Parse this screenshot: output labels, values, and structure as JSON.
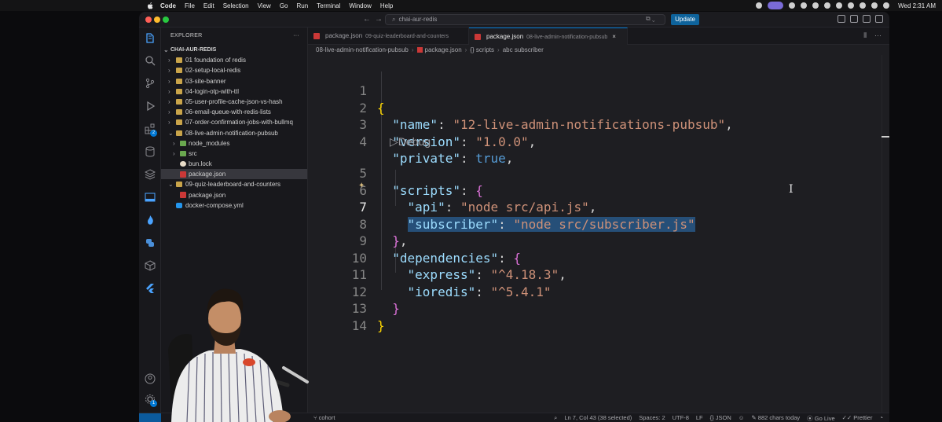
{
  "menubar": {
    "app_name": "Code",
    "items": [
      "File",
      "Edit",
      "Selection",
      "View",
      "Go",
      "Run",
      "Terminal",
      "Window",
      "Help"
    ],
    "clock": "Wed 2:31 AM"
  },
  "titlebar": {
    "search_text": "chai-aur-redis",
    "update_label": "Update"
  },
  "activity_badges": {
    "source_control": "2",
    "accounts": "1"
  },
  "explorer": {
    "title": "EXPLORER",
    "more": "···",
    "root": "CHAI-AUR-REDIS",
    "rows": [
      {
        "label": "01 foundation of redis"
      },
      {
        "label": "02-setup-local-redis"
      },
      {
        "label": "03-site-banner"
      },
      {
        "label": "04-login-otp-with-ttl"
      },
      {
        "label": "05-user-profile-cache-json-vs-hash"
      },
      {
        "label": "06-email-queue-with-redis-lists"
      },
      {
        "label": "07-order-confirmation-jobs-with-bullmq"
      },
      {
        "label": "08-live-admin-notification-pubsub"
      },
      {
        "label": "node_modules"
      },
      {
        "label": "src"
      },
      {
        "label": "bun.lock"
      },
      {
        "label": "package.json"
      },
      {
        "label": "09-quiz-leaderboard-and-counters"
      },
      {
        "label": "package.json"
      },
      {
        "label": "docker-compose.yml"
      }
    ]
  },
  "tabs": [
    {
      "label": "package.json",
      "sub": "09-quiz-leaderboard-and-counters"
    },
    {
      "label": "package.json",
      "sub": "08-live-admin-notification-pubsub",
      "close": "×"
    }
  ],
  "breadcrumb": {
    "folder": "08-live-admin-notification-pubsub",
    "file": "package.json",
    "section": "{} scripts",
    "symbol": "abc subscriber"
  },
  "editor": {
    "line_numbers": [
      "1",
      "2",
      "3",
      "4",
      "5",
      "6",
      "7",
      "8",
      "9",
      "10",
      "11",
      "12",
      "13",
      "14"
    ],
    "current_line": 7,
    "codelens": "Debug",
    "tokens": {
      "l1_open": "{",
      "name_key": "\"name\"",
      "name_val": "\"12-live-admin-notifications-pubsub\"",
      "version_key": "\"version\"",
      "version_val": "\"1.0.0\"",
      "private_key": "\"private\"",
      "private_val": "true",
      "scripts_key": "\"scripts\"",
      "api_key": "\"api\"",
      "api_val": "\"node src/api.js\"",
      "subscriber_key": "\"subscriber\"",
      "subscriber_val": "\"node src/subscriber.js\"",
      "deps_key": "\"dependencies\"",
      "express_key": "\"express\"",
      "express_val": "\"^4.18.3\"",
      "ioredis_key": "\"ioredis\"",
      "ioredis_val": "\"^5.4.1\""
    }
  },
  "statusbar": {
    "branch": "cohort",
    "position": "Ln 7, Col 43 (38 selected)",
    "spaces": "Spaces: 2",
    "encoding": "UTF-8",
    "eol": "LF",
    "language": "{} JSON",
    "chars": "882 chars today",
    "golive": "Go Live",
    "prettier": "Prettier"
  }
}
